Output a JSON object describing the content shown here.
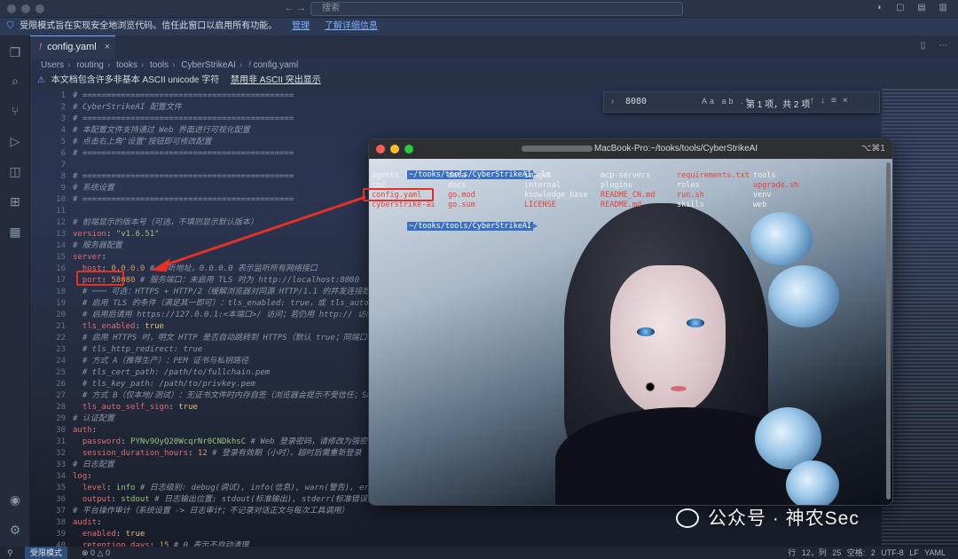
{
  "titlebar": {
    "search_placeholder": "搜索"
  },
  "banner": {
    "text": "受限模式旨在实现安全地浏览代码。信任此窗口以启用所有功能。",
    "manage": "管理",
    "learn_more": "了解详细信息"
  },
  "tab": {
    "icon": "!",
    "label": "config.yaml"
  },
  "breadcrumb": [
    "Users",
    "routing",
    "tooks",
    "tools",
    "CyberStrikeAI",
    "config.yaml"
  ],
  "unicode_warning": {
    "text": "本文档包含许多非基本 ASCII unicode 字符",
    "action": "禁用非 ASCII 突出显示"
  },
  "find": {
    "value": "8080",
    "opts": "Aa ab .*",
    "result": "第 1 项，共 2 项"
  },
  "editor": {
    "line_numbers": [
      "1",
      "2",
      "3",
      "4",
      "5",
      "6",
      "7",
      "8",
      "9",
      "10",
      "11",
      "12",
      "13",
      "14",
      "15",
      "16",
      "17",
      "18",
      "19",
      "20",
      "21",
      "22",
      "23",
      "24",
      "25",
      "26",
      "27",
      "28",
      "29",
      "30",
      "31",
      "32",
      "33",
      "34",
      "35",
      "36",
      "37",
      "38",
      "39",
      "40"
    ],
    "lines": [
      "# ============================================",
      "# CyberStrikeAI 配置文件",
      "# ============================================",
      "# 本配置文件支持通过 Web 界面进行可视化配置",
      "# 点击右上角\"设置\"按钮即可修改配置",
      "# ============================================",
      "",
      "# ============================================",
      "# 系统设置",
      "# ============================================",
      "",
      "# 前端显示的版本号（可选，不填则显示默认版本）",
      "version: \"v1.6.51\"",
      "# 服务器配置",
      "server:",
      "  host: 0.0.0.0 # 监听地址，0.0.0.0 表示监听所有网络接口",
      "  port: 58080 # 服务端口：未启用 TLS 时为 http://localhost:8080",
      "  # ─── 可选：HTTPS + HTTP/2（缓解浏览器对同源 HTTP/1.1 的并发连接数限",
      "  # 启用 TLS 的条件（满足其一即可）：tls_enabled: true，或 tls_auto_s",
      "  # 启用后请用 https://127.0.0.1:<本端口>/ 访问；若仍用 http:// 访问同",
      "  tls_enabled: true",
      "  # 启用 HTTPS 时，明文 HTTP 是否自动跳转到 HTTPS（默认 true；同端口嗅探",
      "  # tls_http_redirect: true",
      "  # 方式 A（推荐生产）：PEM 证书与私钥路径",
      "  # tls_cert_path: /path/to/fullchain.pem",
      "  # tls_key_path: /path/to/privkey.pem",
      "  # 方式 B（仅本地/测试）：无证书文件时内存自签（浏览器会提示不受信任；SAN",
      "  tls_auto_self_sign: true",
      "# 认证配置",
      "auth:",
      "  password: PYNv9OyQ20WcqrNr0CNDkhsC # Web 登录密码，请修改为强密码",
      "  session_duration_hours: 12 # 登录有效期（小时），超时后需重新登录",
      "# 日志配置",
      "log:",
      "  level: info # 日志级别: debug(调试), info(信息), warn(警告), erro",
      "  output: stdout # 日志输出位置: stdout(标准输出), stderr(标准错误),",
      "# 平台操作审计（系统设置 -> 日志审计；不记录对话正文与每次工具调用）",
      "audit:",
      "  enabled: true",
      "  retention_days: 15 # 0 表示不自动清理"
    ]
  },
  "terminal": {
    "title_suffix": "MacBook-Pro:~/tooks/tools/CyberStrikeAI",
    "shortcut": "⌥⌘1",
    "prompt": "~/tooks/tools/CyberStrikeAI",
    "command": "ls",
    "columns": [
      [
        "agents",
        "cmd",
        "config.yaml",
        "cyberstrike-ai"
      ],
      [
        "data",
        "docs",
        "go.mod",
        "go.sum"
      ],
      [
        "images",
        "internal",
        "knowledge_base",
        "LICENSE"
      ],
      [
        "mcp-servers",
        "plugins",
        "README_CN.md",
        "README.md"
      ],
      [
        "requirements.txt",
        "roles",
        "run.sh",
        "skills"
      ],
      [
        "tools",
        "upgrade.sh",
        "venv",
        "web"
      ]
    ],
    "second_prompt": "~/tooks/tools/CyberStrikeAI"
  },
  "status": {
    "restricted": "受限模式",
    "errors": "⊗ 0 △ 0",
    "position": "行 12，列 25",
    "spaces": "空格: 2",
    "encoding": "UTF-8",
    "eol": "LF",
    "language": "YAML"
  },
  "watermark": "公众号 · 神农Sec"
}
